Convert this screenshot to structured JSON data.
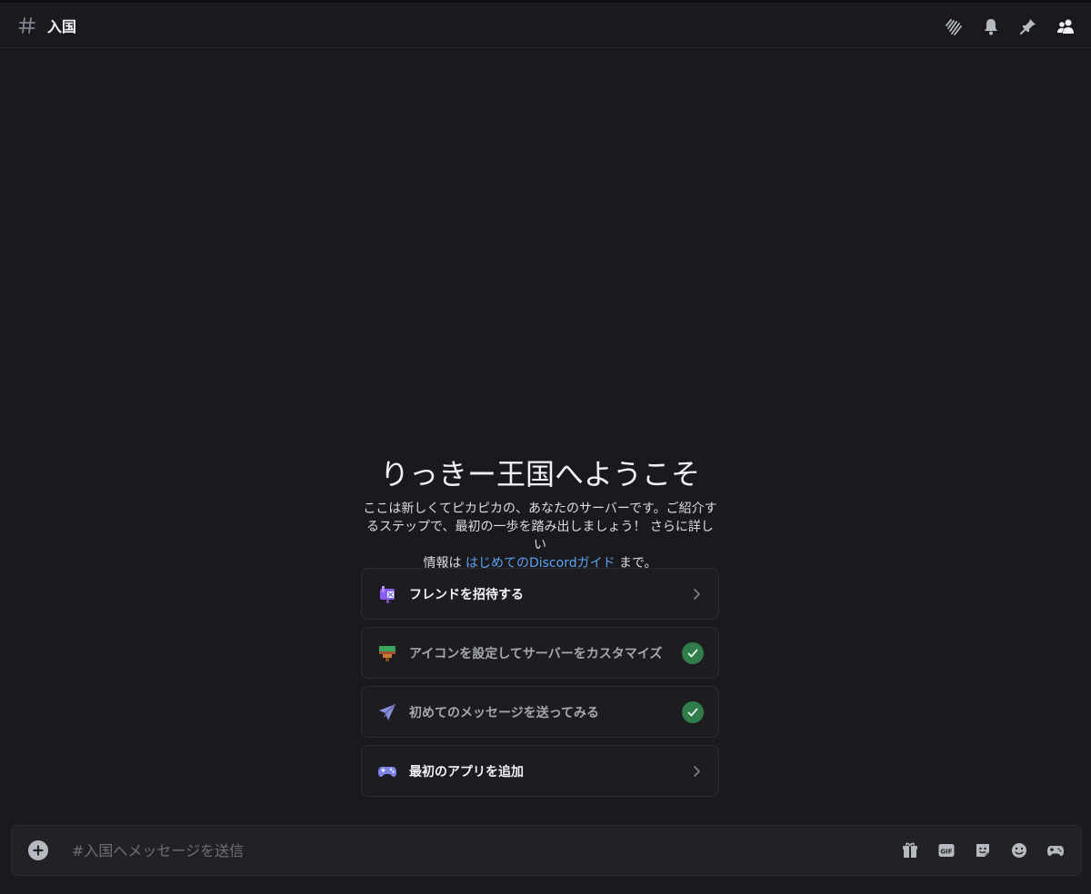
{
  "header": {
    "channel_name": "入国",
    "icons": [
      "threads-icon",
      "bell-icon",
      "pin-icon",
      "members-icon"
    ]
  },
  "welcome": {
    "title": "りっきー王国へようこそ",
    "desc_line1": "ここは新しくてピカピカの、あなたのサーバーです。ご紹介す",
    "desc_line2": "るステップで、最初の一歩を踏み出しましょう！ さらに詳しい",
    "desc_line3_prefix": "情報は ",
    "desc_link": "はじめてのDiscordガイド",
    "desc_line3_suffix": " まで。"
  },
  "tasks": [
    {
      "label": "フレンドを招待する",
      "icon": "mailbox-icon",
      "status": "pending"
    },
    {
      "label": "アイコンを設定してサーバーをカスタマイズ",
      "icon": "paintbrush-icon",
      "status": "done"
    },
    {
      "label": "初めてのメッセージを送ってみる",
      "icon": "paper-plane-icon",
      "status": "done"
    },
    {
      "label": "最初のアプリを追加",
      "icon": "gamepad-icon",
      "status": "pending"
    }
  ],
  "composer": {
    "placeholder": "#入国へメッセージを送信",
    "tools": [
      "gift-icon",
      "gif-icon",
      "sticker-icon",
      "emoji-icon",
      "apps-icon"
    ]
  },
  "colors": {
    "background": "#1a1a1e",
    "link": "#5ca2f2",
    "check": "#2f7d4a"
  }
}
